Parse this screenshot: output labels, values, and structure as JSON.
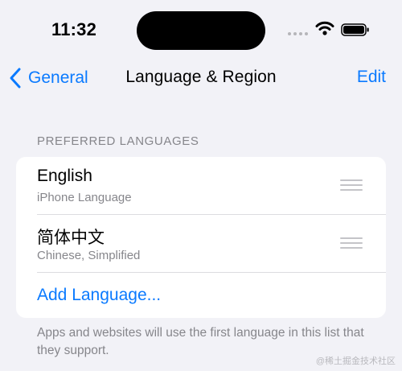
{
  "status_bar": {
    "time": "11:32",
    "icons": [
      "cellular-signal-icon",
      "wifi-icon",
      "battery-icon"
    ]
  },
  "nav": {
    "back_label": "General",
    "title": "Language & Region",
    "edit_label": "Edit",
    "back_icon": "chevron-left-icon"
  },
  "preferred_languages": {
    "header": "PREFERRED LANGUAGES",
    "items": [
      {
        "title": "English",
        "subtitle": "iPhone Language"
      },
      {
        "title": "简体中文",
        "subtitle": "Chinese, Simplified"
      }
    ],
    "add_label": "Add Language...",
    "footer": "Apps and websites will use the first language in this list that they support."
  },
  "watermark": "@稀土掘金技术社区",
  "colors": {
    "background": "#f2f2f7",
    "accent": "#0a7aff",
    "secondary_text": "#86868b",
    "card": "#ffffff"
  }
}
